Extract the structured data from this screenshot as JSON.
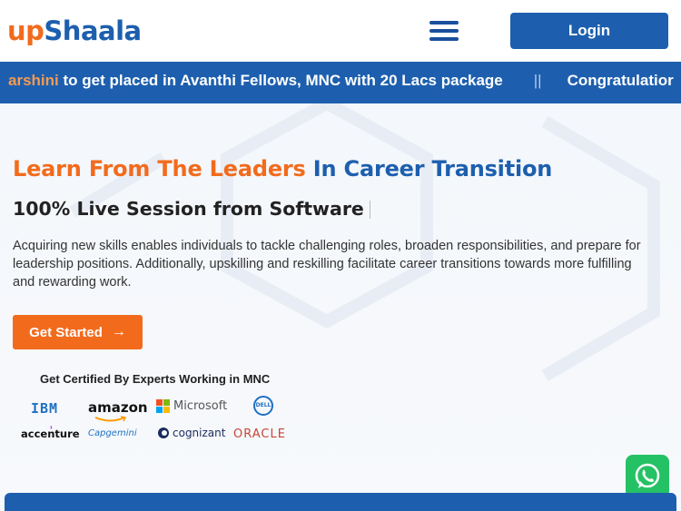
{
  "header": {
    "logo_up": "up",
    "logo_shaala": "Shaala",
    "login_label": "Login"
  },
  "ticker": {
    "name": "arshini",
    "message": " to get placed in Avanthi Fellows, MNC with 20 Lacs package",
    "separator": "||",
    "next_message": "Congratulatior"
  },
  "hero": {
    "headline_orange": "Learn From The Leaders",
    "headline_blue": "In Career Transition",
    "subhead": "100% Live Session from Software",
    "description": "Acquiring new skills enables individuals to tackle challenging roles, broaden responsibilities, and prepare for leadership positions. Additionally, upskilling and reskilling facilitate career transitions towards more fulfilling and rewarding work.",
    "cta_label": "Get Started",
    "cta_icon": "arrow-right-icon",
    "cert_title": "Get Certified By Experts Working in MNC"
  },
  "logos": {
    "ibm": "IBM",
    "amazon": "amazon",
    "microsoft": "Microsoft",
    "dell": "DELL",
    "accenture": "accenture",
    "capgemini": "Capgemini",
    "cognizant": "cognizant",
    "oracle": "ORACLE"
  },
  "colors": {
    "brand_orange": "#f26b1d",
    "brand_blue": "#1d5fae",
    "whatsapp_green": "#25c265"
  }
}
